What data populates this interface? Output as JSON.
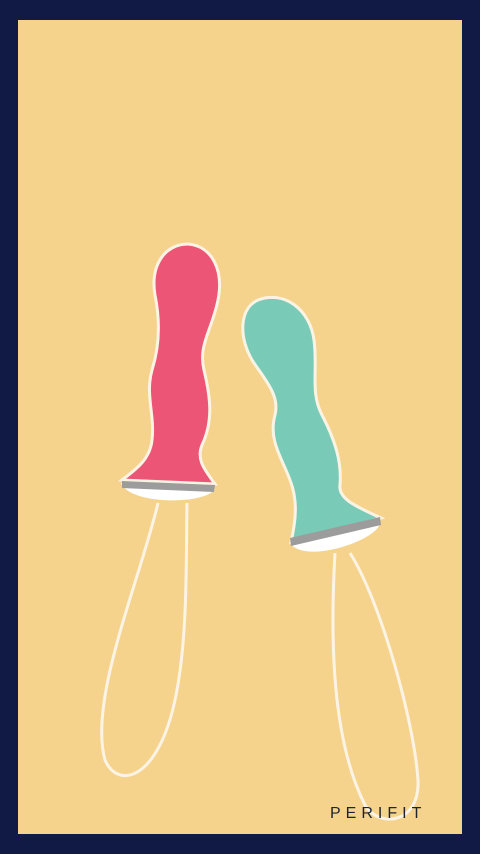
{
  "brand": {
    "text": "PERIFIT"
  },
  "illustration": {
    "items": [
      {
        "name": "pink-probe",
        "color": "#ec5576"
      },
      {
        "name": "teal-probe",
        "color": "#79cbb8"
      }
    ]
  },
  "colors": {
    "frame": "#111a45",
    "background": "#f5d38c",
    "outline": "#fbf4e4",
    "band": "#9c9c9c",
    "base": "#ffffff",
    "cord": "#fbf4e4"
  }
}
